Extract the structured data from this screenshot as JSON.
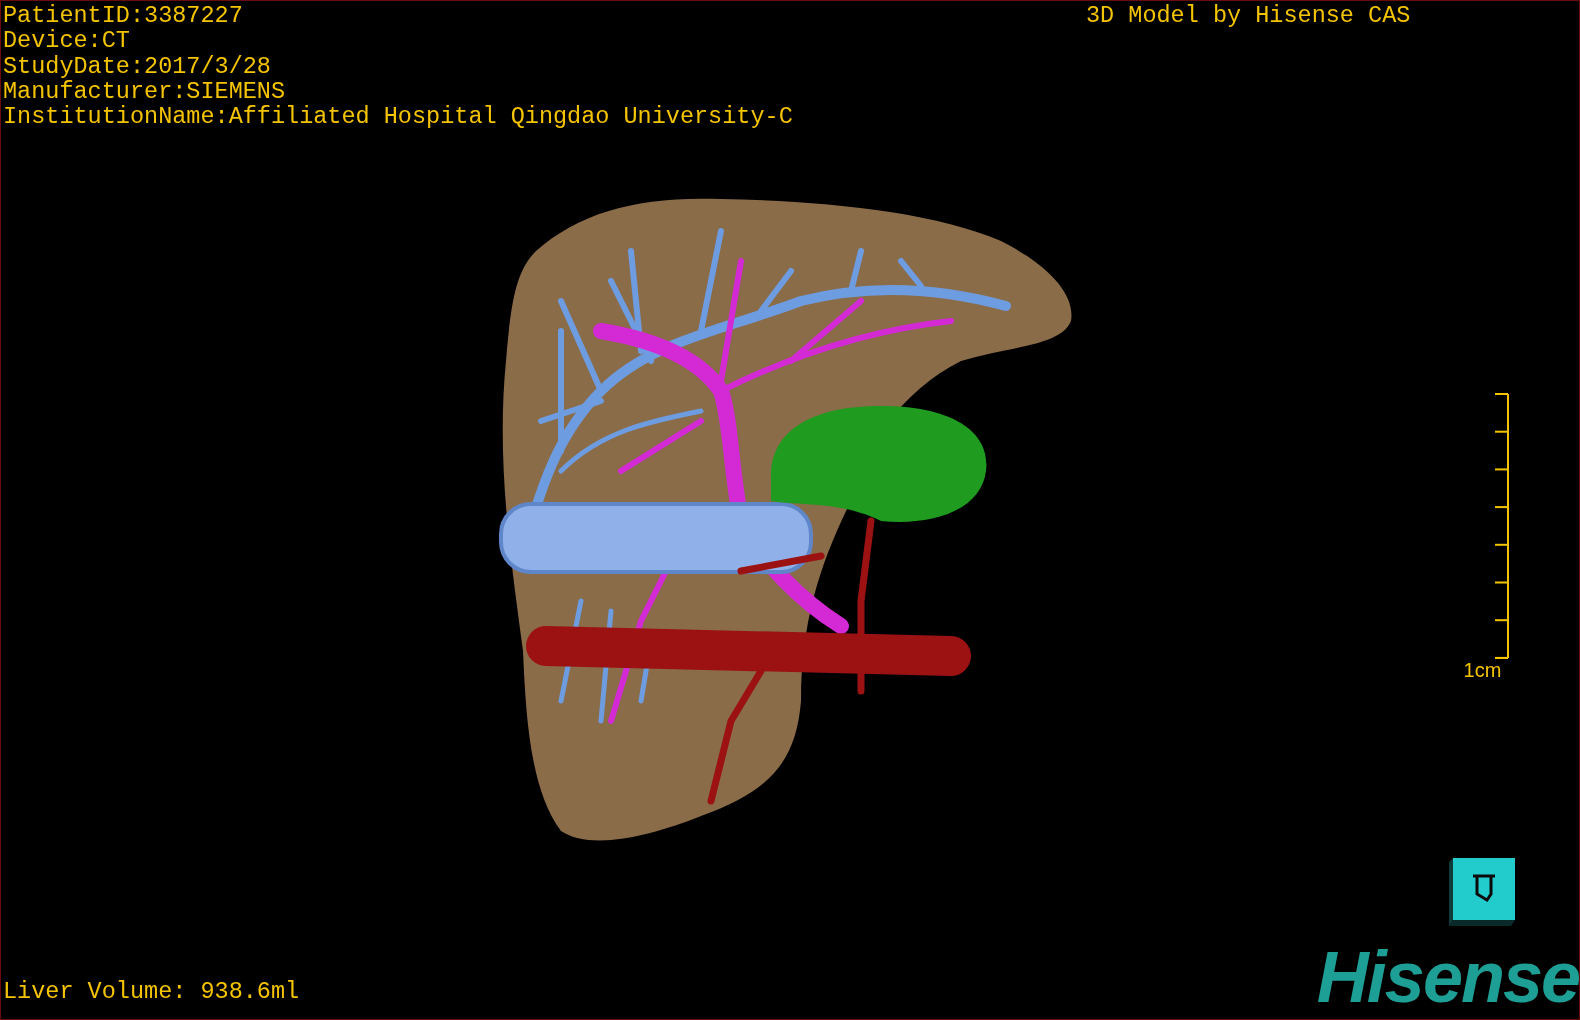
{
  "patient_info": [
    "PatientID:3387227",
    "Device:CT",
    "StudyDate:2017/3/28",
    "Manufacturer:SIEMENS",
    "InstitutionName:Affiliated Hospital Qingdao University-C"
  ],
  "title": "3D Model by Hisense CAS",
  "scale_bar": {
    "label": "1cm"
  },
  "volume": "Liver Volume: 938.6ml",
  "logo": {
    "text": "Hisense"
  }
}
